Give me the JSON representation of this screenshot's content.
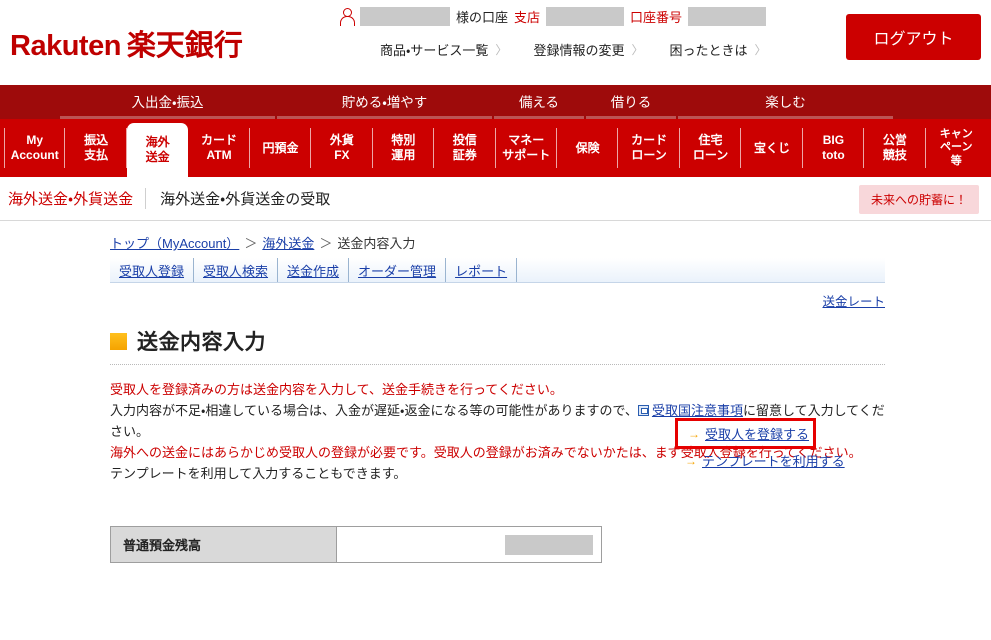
{
  "header": {
    "logo_mark": "Rakuten",
    "logo_jp": "楽天銀行",
    "account_suffix": "様の口座",
    "branch_label": "支店",
    "account_no_label": "口座番号",
    "links": [
      {
        "label": "商品・サービス一覧",
        "chevron": "〉"
      },
      {
        "label": "登録情報の変更",
        "chevron": "〉"
      },
      {
        "label": "困ったときは",
        "chevron": "〉"
      }
    ],
    "logout_label": "ログアウト"
  },
  "global_nav": [
    {
      "label": "入出金・振込"
    },
    {
      "label": "貯める・増やす"
    },
    {
      "label": "備える"
    },
    {
      "label": "借りる"
    },
    {
      "label": "楽しむ"
    }
  ],
  "tabs": [
    {
      "label": "My\nAccount",
      "line1": "My",
      "line2": "Account",
      "active": false
    },
    {
      "label": "振込支払",
      "line1": "振込",
      "line2": "支払",
      "active": false
    },
    {
      "label": "海外送金",
      "line1": "海外",
      "line2": "送金",
      "active": true
    },
    {
      "label": "カードATM",
      "line1": "カード",
      "line2": "ATM",
      "active": false
    },
    {
      "label": "円預金",
      "line1": "円預金",
      "line2": "",
      "active": false
    },
    {
      "label": "外貨FX",
      "line1": "外貨",
      "line2": "FX",
      "active": false
    },
    {
      "label": "特別運用",
      "line1": "特別",
      "line2": "運用",
      "active": false
    },
    {
      "label": "投信証券",
      "line1": "投信",
      "line2": "証券",
      "active": false
    },
    {
      "label": "マネーサポート",
      "line1": "マネー",
      "line2": "サポート",
      "active": false
    },
    {
      "label": "保険",
      "line1": "保険",
      "line2": "",
      "active": false
    },
    {
      "label": "カードローン",
      "line1": "カード",
      "line2": "ローン",
      "active": false
    },
    {
      "label": "住宅ローン",
      "line1": "住宅",
      "line2": "ローン",
      "active": false
    },
    {
      "label": "宝くじ",
      "line1": "宝くじ",
      "line2": "",
      "active": false
    },
    {
      "label": "BIG toto",
      "line1": "BIG",
      "line2": "toto",
      "active": false
    },
    {
      "label": "公営競技",
      "line1": "公営",
      "line2": "競技",
      "active": false
    },
    {
      "label": "キャンペーン等",
      "line1": "キャン",
      "line2": "ペーン",
      "line3": "等",
      "active": false
    }
  ],
  "titlebar": {
    "category": "海外送金・外貨送金",
    "page": "海外送金・外貨送金の受取",
    "badge": "未来への貯蓄に！"
  },
  "breadcrumb": {
    "top": "トップ（MyAccount）",
    "sep": "＞",
    "second": "海外送金",
    "current": "送金内容入力"
  },
  "subtabs": [
    {
      "label": "受取人登録"
    },
    {
      "label": "受取人検索"
    },
    {
      "label": "送金作成"
    },
    {
      "label": "オーダー管理"
    },
    {
      "label": "レポート"
    }
  ],
  "rate_link": "送金レート",
  "section": {
    "title": "送金内容入力"
  },
  "body": {
    "line_red_1": "受取人を登録済みの方は送金内容を入力して、送金手続きを行ってください。",
    "line_black_1a": "入力内容が不足・相違している場合は、入金が遅延・返金になる等の可能性がありますので、",
    "line_black_link": "受取国注意事項",
    "line_black_1b": "に留意して入力してください。",
    "line_red_2": "海外への送金にはあらかじめ受取人の登録が必要です。受取人の登録がお済みでないかたは、まず受取人登録を行ってください。",
    "line_black_2": "テンプレートを利用して入力することもできます。"
  },
  "actions": [
    {
      "label": "受取人を登録する",
      "arrow": "→",
      "highlighted": true
    },
    {
      "label": "テンプレートを利用する",
      "arrow": "→",
      "highlighted": false
    }
  ],
  "balance_table": {
    "row_label": "普通預金残高"
  },
  "colors": {
    "brand_red": "#cc0000",
    "nav_dark_red": "#9e0b0b",
    "link_blue": "#1a3fa8",
    "accent_orange": "#f5a300",
    "highlight_border": "#e60000",
    "badge_pink": "#f8d7da",
    "mask_gray": "#c9c9c9"
  }
}
